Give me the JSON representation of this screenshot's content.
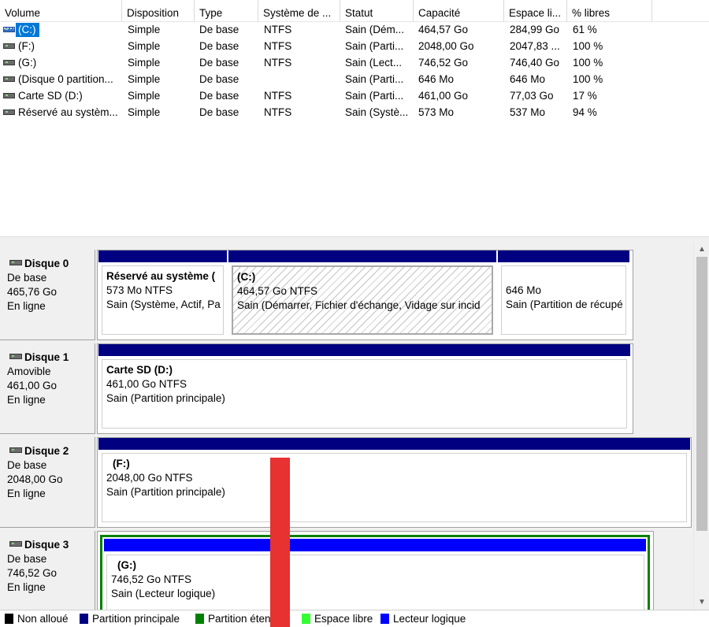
{
  "columns": [
    "Volume",
    "Disposition",
    "Type",
    "Système de ...",
    "Statut",
    "Capacité",
    "Espace li...",
    "% libres"
  ],
  "volumes": [
    {
      "name": "(C:)",
      "layout": "Simple",
      "type": "De base",
      "fs": "NTFS",
      "status": "Sain (Dém...",
      "capacity": "464,57 Go",
      "free": "284,99 Go",
      "pct": "61 %",
      "selected": true
    },
    {
      "name": "(F:)",
      "layout": "Simple",
      "type": "De base",
      "fs": "NTFS",
      "status": "Sain (Parti...",
      "capacity": "2048,00 Go",
      "free": "2047,83 ...",
      "pct": "100 %"
    },
    {
      "name": "(G:)",
      "layout": "Simple",
      "type": "De base",
      "fs": "NTFS",
      "status": "Sain (Lect...",
      "capacity": "746,52 Go",
      "free": "746,40 Go",
      "pct": "100 %"
    },
    {
      "name": "(Disque 0 partition...",
      "layout": "Simple",
      "type": "De base",
      "fs": "",
      "status": "Sain (Parti...",
      "capacity": "646 Mo",
      "free": "646 Mo",
      "pct": "100 %"
    },
    {
      "name": "Carte SD (D:)",
      "layout": "Simple",
      "type": "De base",
      "fs": "NTFS",
      "status": "Sain (Parti...",
      "capacity": "461,00 Go",
      "free": "77,03 Go",
      "pct": "17 %"
    },
    {
      "name": "Réservé au systèm...",
      "layout": "Simple",
      "type": "De base",
      "fs": "NTFS",
      "status": "Sain (Systè...",
      "capacity": "573 Mo",
      "free": "537 Mo",
      "pct": "94 %"
    }
  ],
  "disks": [
    {
      "name": "Disque 0",
      "kind": "De base",
      "size": "465,76 Go",
      "state": "En ligne",
      "partitions": [
        {
          "name": "Réservé au système  (",
          "size": "573 Mo NTFS",
          "status": "Sain (Système, Actif, Pa"
        },
        {
          "name": "(C:)",
          "size": "464,57 Go NTFS",
          "status": "Sain (Démarrer, Fichier d'échange, Vidage sur incid",
          "selected": true
        },
        {
          "name": "",
          "size": "646 Mo",
          "status": "Sain (Partition de récupé"
        }
      ]
    },
    {
      "name": "Disque 1",
      "kind": "Amovible",
      "size": "461,00 Go",
      "state": "En ligne",
      "partitions": [
        {
          "name": "Carte SD  (D:)",
          "size": "461,00 Go NTFS",
          "status": "Sain (Partition principale)"
        }
      ]
    },
    {
      "name": "Disque 2",
      "kind": "De base",
      "size": "2048,00 Go",
      "state": "En ligne",
      "partitions": [
        {
          "name": "(F:)",
          "size": "2048,00 Go NTFS",
          "status": "Sain (Partition principale)"
        }
      ]
    },
    {
      "name": "Disque 3",
      "kind": "De base",
      "size": "746,52 Go",
      "state": "En ligne",
      "partitions": [
        {
          "name": "(G:)",
          "size": "746,52 Go NTFS",
          "status": "Sain (Lecteur logique)"
        }
      ]
    }
  ],
  "legend": [
    {
      "label": "Non alloué",
      "color": "#000000"
    },
    {
      "label": "Partition principale",
      "color": "#000080"
    },
    {
      "label": "Partition étendue",
      "color": "#008000"
    },
    {
      "label": "Espace libre",
      "color": "#33ff33"
    },
    {
      "label": "Lecteur logique",
      "color": "#0000ff"
    }
  ],
  "scrollbar": {
    "up_icon": "chevron-up-icon",
    "down_icon": "chevron-down-icon"
  },
  "annotation_color": "#e83131"
}
